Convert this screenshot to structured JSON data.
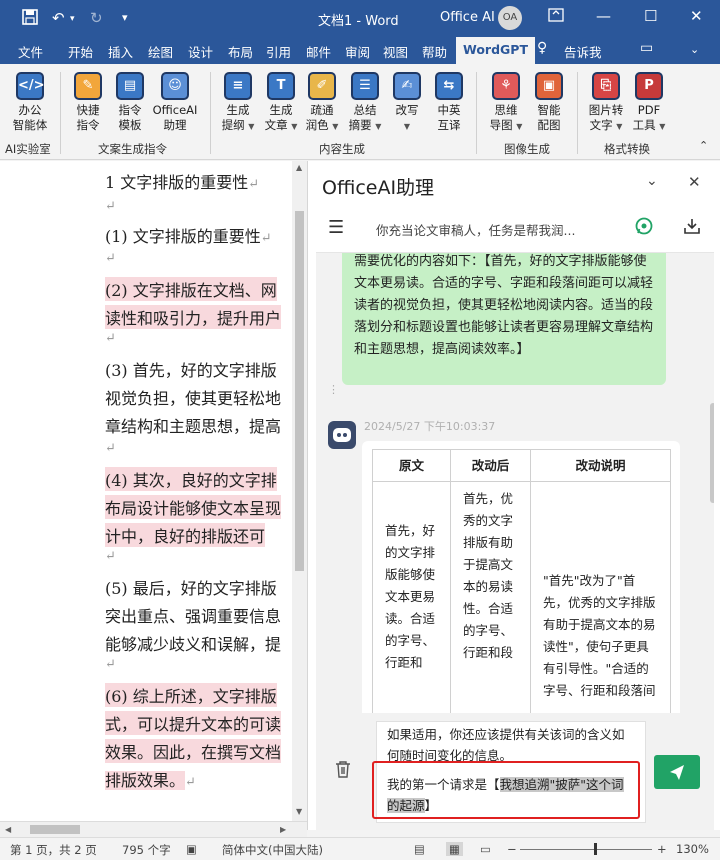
{
  "titlebar": {
    "doc_title": "文档1 - Word",
    "account_name": "Office AI",
    "avatar_initials": "OA",
    "save_icon": "save-icon",
    "undo_icon": "undo-icon",
    "redo_icon": "redo-icon"
  },
  "menu": {
    "tabs": [
      "文件",
      "开始",
      "插入",
      "绘图",
      "设计",
      "布局",
      "引用",
      "邮件",
      "审阅",
      "视图",
      "帮助",
      "WordGPT"
    ],
    "active_tab": "WordGPT",
    "tell_me": "告诉我"
  },
  "ribbon": {
    "groups": [
      "AI实验室",
      "文案生成指令",
      "内容生成",
      "图像生成",
      "格式转换"
    ],
    "buttons": [
      {
        "line1": "办公",
        "line2": "智能体",
        "icon": "agent-icon",
        "dropdown": false
      },
      {
        "line1": "快捷",
        "line2": "指令",
        "icon": "quick-command-icon",
        "dropdown": false
      },
      {
        "line1": "指令",
        "line2": "模板",
        "icon": "template-icon",
        "dropdown": false
      },
      {
        "line1": "OfficeAI",
        "line2": "助理",
        "icon": "assistant-icon",
        "dropdown": false
      },
      {
        "line1": "生成",
        "line2": "提纲",
        "icon": "outline-icon",
        "dropdown": true
      },
      {
        "line1": "生成",
        "line2": "文章",
        "icon": "article-icon",
        "dropdown": true
      },
      {
        "line1": "疏通",
        "line2": "润色",
        "icon": "polish-icon",
        "dropdown": true
      },
      {
        "line1": "总结",
        "line2": "摘要",
        "icon": "summary-icon",
        "dropdown": true
      },
      {
        "line1": "改写",
        "line2": "",
        "icon": "rewrite-icon",
        "dropdown": true
      },
      {
        "line1": "中英",
        "line2": "互译",
        "icon": "translate-icon",
        "dropdown": false
      },
      {
        "line1": "思维",
        "line2": "导图",
        "icon": "mindmap-icon",
        "dropdown": true
      },
      {
        "line1": "智能",
        "line2": "配图",
        "icon": "image-icon",
        "dropdown": false
      },
      {
        "line1": "图片转",
        "line2": "文字",
        "icon": "ocr-icon",
        "dropdown": true
      },
      {
        "line1": "PDF",
        "line2": "工具",
        "icon": "pdf-icon",
        "dropdown": true
      }
    ]
  },
  "document": {
    "lines": [
      {
        "text": "1  文字排版的重要性",
        "highlight": false
      },
      {
        "text": "(1)  文字排版的重要性",
        "highlight": false
      },
      {
        "text": "(2)  文字排版在文档、网",
        "highlight": true
      },
      {
        "text": "读性和吸引力，提升用户",
        "highlight": true
      },
      {
        "text": "(3)  首先，好的文字排版",
        "highlight": false
      },
      {
        "text": "视觉负担，使其更轻松地",
        "highlight": false
      },
      {
        "text": "章结构和主题思想，提高",
        "highlight": false
      },
      {
        "text": "(4)  其次，良好的文字排",
        "highlight": true
      },
      {
        "text": "布局设计能够使文本呈现",
        "highlight": true
      },
      {
        "text": "计中，良好的排版还可",
        "highlight": true
      },
      {
        "text": "(5)  最后，好的文字排版",
        "highlight": false
      },
      {
        "text": "突出重点、强调重要信息",
        "highlight": false
      },
      {
        "text": "能够减少歧义和误解，提",
        "highlight": false
      },
      {
        "text": "(6)  综上所述，文字排版",
        "highlight": true
      },
      {
        "text": "式，可以提升文本的可读",
        "highlight": true
      },
      {
        "text": "效果。因此，在撰写文档",
        "highlight": true
      },
      {
        "text": "排版效果。",
        "highlight": true
      }
    ]
  },
  "assistant": {
    "title": "OfficeAI助理",
    "prompt_preview": "你充当论文审稿人，任务是帮我润...",
    "user_message": "需要优化的内容如下：【首先，好的文字排版能够使文本更易读。合适的字号、字距和段落间距可以减轻读者的视觉负担，使其更轻松地阅读内容。适当的段落划分和标题设置也能够让读者更容易理解文章结构和主题思想，提高阅读效率。】",
    "bot_time": "2024/5/27 下午10:03:37",
    "table": {
      "headers": [
        "原文",
        "改动后",
        "改动说明"
      ],
      "row": [
        "首先，好的文字排版能够使文本更易读。合适的字号、行距和",
        "首先，优秀的文字排版有助于提高文本的易读性。合适的字号、行距和段",
        "\"首先\"改为了\"首先，优秀的文字排版有助于提高文本的易读性\"，使句子更具有引导性。\"合适的字号、行距和段落间"
      ]
    },
    "input_text_1": "如果适用，你还应该提供有关该词的含义如何随时间变化的信息。",
    "input_text_2_prefix": "我的第一个请求是【",
    "input_text_2_selected": "我想追溯\"披萨\"这个词的起源",
    "input_text_2_suffix": "】"
  },
  "statusbar": {
    "page": "第 1 页，共 2 页",
    "words": "795 个字",
    "language": "简体中文(中国大陆)",
    "zoom": "130%"
  }
}
